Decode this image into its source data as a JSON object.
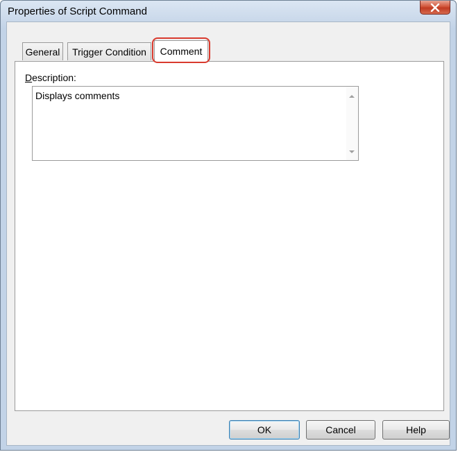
{
  "window": {
    "title": "Properties of Script Command",
    "close_label": "x"
  },
  "tabs": [
    {
      "label": "General",
      "active": false
    },
    {
      "label": "Trigger Condition",
      "active": false
    },
    {
      "label": "Comment",
      "active": true
    }
  ],
  "comment": {
    "description_label_mnemonic": "D",
    "description_label_rest": "escription:",
    "description_value": "Displays comments"
  },
  "buttons": {
    "ok": "OK",
    "cancel": "Cancel",
    "help": "Help"
  },
  "colors": {
    "highlight": "#d93a2e",
    "title_bar": "#c2d3e7",
    "close_button": "#c13b22"
  }
}
